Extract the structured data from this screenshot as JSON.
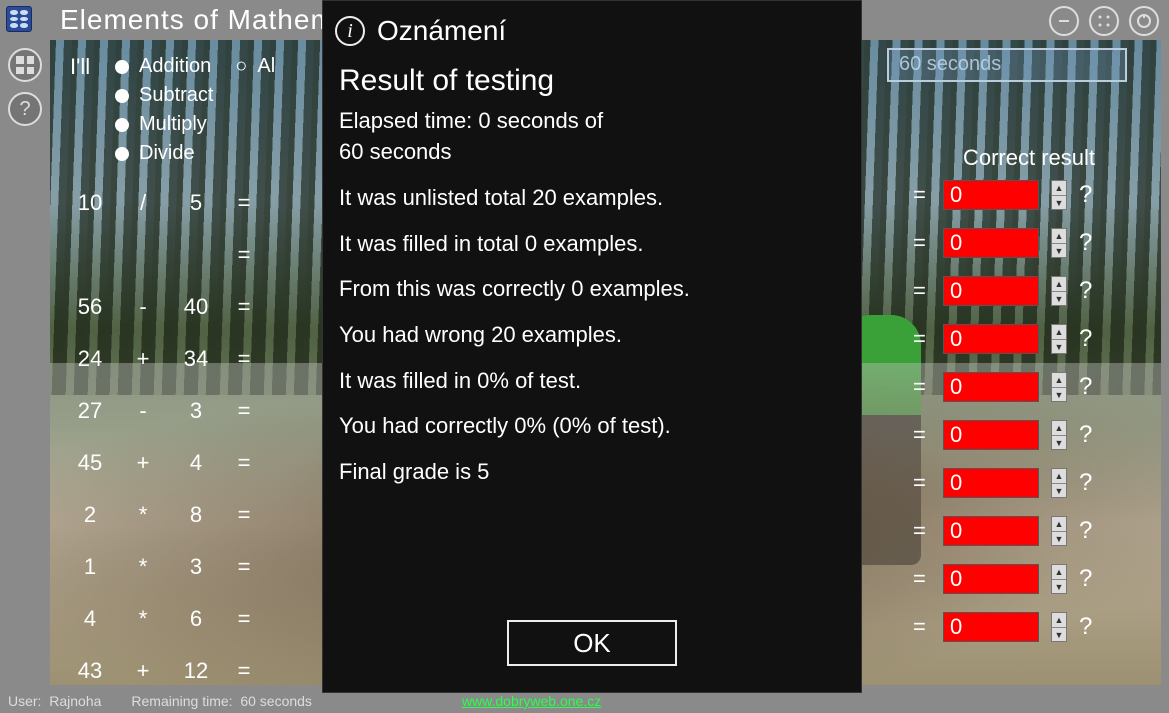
{
  "title": "Elements of Mathem",
  "practice_label": "I'll",
  "all_label": "Al",
  "operations": [
    "Addition",
    "Subtract",
    "Multiply",
    "Divide"
  ],
  "timer_text": "60 seconds",
  "correct_header": "Correct result",
  "problems": [
    {
      "a": "10",
      "op": "/",
      "b": "5"
    },
    {
      "a": "",
      "op": "",
      "b": ""
    },
    {
      "a": "56",
      "op": "-",
      "b": "40"
    },
    {
      "a": "24",
      "op": "+",
      "b": "34"
    },
    {
      "a": "27",
      "op": "-",
      "b": "3"
    },
    {
      "a": "45",
      "op": "+",
      "b": "4"
    },
    {
      "a": "2",
      "op": "*",
      "b": "8"
    },
    {
      "a": "1",
      "op": "*",
      "b": "3"
    },
    {
      "a": "4",
      "op": "*",
      "b": "6"
    },
    {
      "a": "43",
      "op": "+",
      "b": "12"
    }
  ],
  "answers": [
    "0",
    "0",
    "0",
    "0",
    "0",
    "0",
    "0",
    "0",
    "0",
    "0"
  ],
  "qmark": "?",
  "eq": "=",
  "status": {
    "user_label": "User:",
    "user_value": "Rajnoha",
    "time_label": "Remaining time:",
    "time_value": "60 seconds",
    "link": "www.dobryweb.one.cz"
  },
  "modal": {
    "header": "Oznámení",
    "heading": "Result of testing",
    "line1a": "Elapsed time: 0 seconds of",
    "line1b": " 60 seconds",
    "line2": "It was unlisted total 20 examples.",
    "line3": "It was filled in total 0 examples.",
    "line4": "From this was correctly 0 examples.",
    "line5": "You had wrong 20 examples.",
    "line6": "It was filled in 0% of test.",
    "line7": "You had correctly 0% (0% of test).",
    "line8": "Final grade is 5",
    "ok": "OK"
  }
}
